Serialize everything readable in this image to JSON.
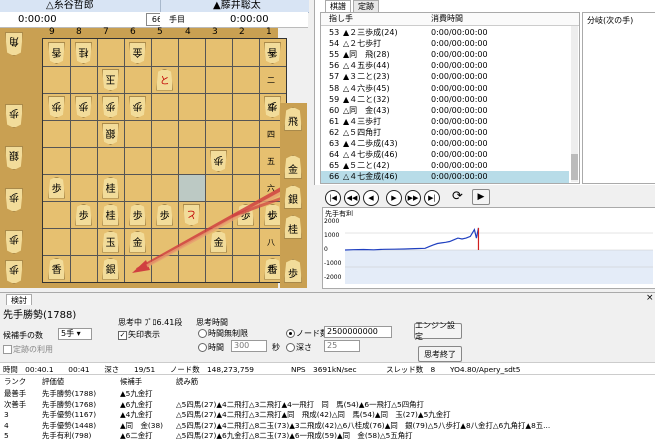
{
  "players": {
    "gote": {
      "name": "△糸谷哲郎",
      "time": "0:00:00"
    },
    "sente": {
      "name": "▲藤井聡太",
      "time": "0:00:00"
    },
    "move_count": "66",
    "move_unit": "手目"
  },
  "board": {
    "files": [
      "9",
      "8",
      "7",
      "6",
      "5",
      "4",
      "3",
      "2",
      "1"
    ],
    "ranks": [
      "一",
      "二",
      "三",
      "四",
      "五",
      "六",
      "七",
      "八",
      "九"
    ],
    "pieces": [
      {
        "f": 9,
        "r": 1,
        "p": "香",
        "o": "g"
      },
      {
        "f": 8,
        "r": 1,
        "p": "桂",
        "o": "g"
      },
      {
        "f": 6,
        "r": 1,
        "p": "金",
        "o": "g"
      },
      {
        "f": 1,
        "r": 1,
        "p": "香",
        "o": "g"
      },
      {
        "f": 7,
        "r": 2,
        "p": "玉",
        "o": "g"
      },
      {
        "f": 5,
        "r": 2,
        "p": "と",
        "o": "s",
        "promoted": true
      },
      {
        "f": 9,
        "r": 3,
        "p": "歩",
        "o": "g"
      },
      {
        "f": 8,
        "r": 3,
        "p": "歩",
        "o": "g"
      },
      {
        "f": 7,
        "r": 3,
        "p": "歩",
        "o": "g"
      },
      {
        "f": 6,
        "r": 3,
        "p": "歩",
        "o": "g"
      },
      {
        "f": 1,
        "r": 3,
        "p": "歩",
        "o": "g"
      },
      {
        "f": 7,
        "r": 4,
        "p": "銀",
        "o": "g"
      },
      {
        "f": 3,
        "r": 5,
        "p": "歩",
        "o": "g"
      },
      {
        "f": 9,
        "r": 6,
        "p": "歩",
        "o": "s"
      },
      {
        "f": 7,
        "r": 6,
        "p": "桂",
        "o": "s"
      },
      {
        "f": 8,
        "r": 7,
        "p": "歩",
        "o": "s"
      },
      {
        "f": 7,
        "r": 7,
        "p": "桂",
        "o": "s"
      },
      {
        "f": 6,
        "r": 7,
        "p": "歩",
        "o": "s"
      },
      {
        "f": 5,
        "r": 7,
        "p": "歩",
        "o": "s"
      },
      {
        "f": 4,
        "r": 7,
        "p": "と",
        "o": "g",
        "promoted": true
      },
      {
        "f": 2,
        "r": 7,
        "p": "歩",
        "o": "s"
      },
      {
        "f": 1,
        "r": 7,
        "p": "歩",
        "o": "s"
      },
      {
        "f": 7,
        "r": 8,
        "p": "玉",
        "o": "s"
      },
      {
        "f": 6,
        "r": 8,
        "p": "金",
        "o": "s"
      },
      {
        "f": 3,
        "r": 8,
        "p": "金",
        "o": "s"
      },
      {
        "f": 9,
        "r": 9,
        "p": "香",
        "o": "s"
      },
      {
        "f": 7,
        "r": 9,
        "p": "銀",
        "o": "s"
      },
      {
        "f": 1,
        "r": 9,
        "p": "香",
        "o": "s"
      }
    ]
  },
  "hands": {
    "gote": [
      "角",
      "歩",
      "銀",
      "歩",
      "歩",
      "歩"
    ],
    "sente": [
      "飛",
      "金",
      "銀",
      "桂",
      "歩"
    ]
  },
  "tabs": {
    "kifu": "棋譜",
    "joseki": "定跡"
  },
  "kifu": {
    "col_move": "指し手",
    "col_time": "消費時間",
    "branch_label": "分岐(次の手)",
    "rows": [
      {
        "n": "53",
        "m": "▲２三歩成(24)",
        "t": "0:00/00:00:00"
      },
      {
        "n": "54",
        "m": "△２七歩打",
        "t": "0:00/00:00:00"
      },
      {
        "n": "55",
        "m": "▲同　飛(28)",
        "t": "0:00/00:00:00"
      },
      {
        "n": "56",
        "m": "△４五歩(44)",
        "t": "0:00/00:00:00"
      },
      {
        "n": "57",
        "m": "▲３二と(23)",
        "t": "0:00/00:00:00"
      },
      {
        "n": "58",
        "m": "△４六歩(45)",
        "t": "0:00/00:00:00"
      },
      {
        "n": "59",
        "m": "▲４二と(32)",
        "t": "0:00/00:00:00"
      },
      {
        "n": "60",
        "m": "△同　金(43)",
        "t": "0:00/00:00:00"
      },
      {
        "n": "61",
        "m": "▲４三歩打",
        "t": "0:00/00:00:00"
      },
      {
        "n": "62",
        "m": "△５四角打",
        "t": "0:00/00:00:00"
      },
      {
        "n": "63",
        "m": "▲４二歩成(43)",
        "t": "0:00/00:00:00"
      },
      {
        "n": "64",
        "m": "△４七歩成(46)",
        "t": "0:00/00:00:00"
      },
      {
        "n": "65",
        "m": "▲５二と(42)",
        "t": "0:00/00:00:00"
      },
      {
        "n": "66",
        "m": "△４七金成(46)",
        "t": "0:00/00:00:00"
      }
    ]
  },
  "nav": [
    "|◀",
    "◀◀",
    "◀",
    "▶",
    "▶▶",
    "▶|"
  ],
  "graph": {
    "title": "先手有利",
    "y_ticks": [
      "2000",
      "1000",
      "0",
      "-1000",
      "-2000"
    ],
    "chart_data": {
      "type": "line",
      "ylim": [
        -2000,
        2000
      ],
      "x": [
        1,
        5,
        10,
        15,
        20,
        25,
        30,
        35,
        40,
        42,
        44,
        46,
        48,
        50,
        52,
        54,
        56,
        58,
        60,
        62,
        64,
        65,
        66
      ],
      "values": [
        0,
        20,
        30,
        10,
        40,
        50,
        60,
        80,
        100,
        200,
        300,
        380,
        420,
        450,
        500,
        600,
        700,
        650,
        700,
        800,
        1200,
        700,
        1300
      ]
    }
  },
  "analysis": {
    "tab": "検討",
    "candidate_header": "先手勝勢(1788)",
    "candidates_label": "候補手の数",
    "candidates_value": "5手",
    "joseki_label": "定跡の利用",
    "thinking_engine": "思考中 ﾌﾟﾛ6.41段",
    "arrow_label": "矢印表示",
    "time_group": "思考時間",
    "unlimited_label": "時間無制限",
    "time_label": "時間",
    "time_value": "300",
    "sec_label": "秒",
    "node_label": "ノード数",
    "node_value": "2500000000",
    "depth_label": "深さ",
    "depth_value": "25",
    "settings_btn": "エンジン設定",
    "stop_btn": "思考終了",
    "stats": "時間　00:40.1　　00:41　　深さ　　19/51　　ノード数　148,273,759　　　　　NPS　3691kN/sec　　　　スレッド数　8　　YO4.80/Apery_sdt5",
    "pv_headers": {
      "rank": "ランク",
      "eval": "評価値",
      "move": "候補手",
      "pv": "読み筋"
    },
    "pv": [
      {
        "rank": "最善手",
        "eval": "先手勝勢(1788)",
        "move": "▲5九金打",
        "line": ""
      },
      {
        "rank": "次善手",
        "eval": "先手勝勢(1768)",
        "move": "▲6九金打",
        "line": "△5四馬(27)▲4二飛打△3二飛打▲4一飛打　同　馬(54)▲6一飛打△5四角打"
      },
      {
        "rank": "3",
        "eval": "先手優勢(1167)",
        "move": "▲4九金打",
        "line": "△5四馬(27)▲4二飛打△3二飛打▲同　飛成(42)△同　馬(54)▲同　玉(27)▲5九金打"
      },
      {
        "rank": "4",
        "eval": "先手優勢(1448)",
        "move": "▲同　金(38)",
        "line": "△5四馬(27)▲4二飛打△8二玉(73)▲3二飛成(42)△6八桂成(76)▲同　銀(79)△5八歩打▲8八金打△6九角打▲8五..."
      },
      {
        "rank": "5",
        "eval": "先手有利(798)",
        "move": "▲6二金打",
        "line": "△5四馬(27)▲6九金打△8二玉(73)▲6一飛成(59)▲同　金(58)△5五角打"
      }
    ]
  }
}
